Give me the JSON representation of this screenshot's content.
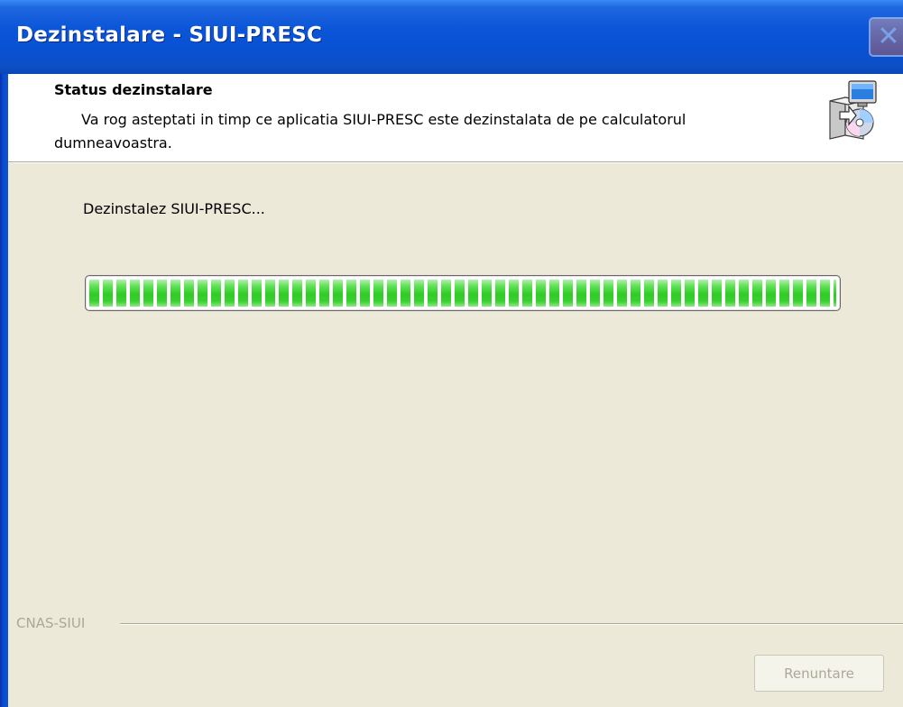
{
  "window": {
    "title": "Dezinstalare - SIUI-PRESC",
    "close_symbol": "✕"
  },
  "header": {
    "title": "Status dezinstalare",
    "subtitle": "Va rog asteptati in timp ce aplicatia SIUI-PRESC este dezinstalata de pe calculatorul dumneavoastra.",
    "icon": "installer-icon"
  },
  "body": {
    "status_text": "Dezinstalez SIUI-PRESC...",
    "progress": {
      "value_percent": 100
    }
  },
  "footer": {
    "brand": "CNAS-SIUI",
    "cancel_label": "Renuntare",
    "cancel_enabled": false
  },
  "colors": {
    "title_bar": "#0a55d8",
    "progress_fill": "#2fcc25",
    "dialog_bg": "#ece9d8",
    "disabled_text": "#aca899"
  }
}
